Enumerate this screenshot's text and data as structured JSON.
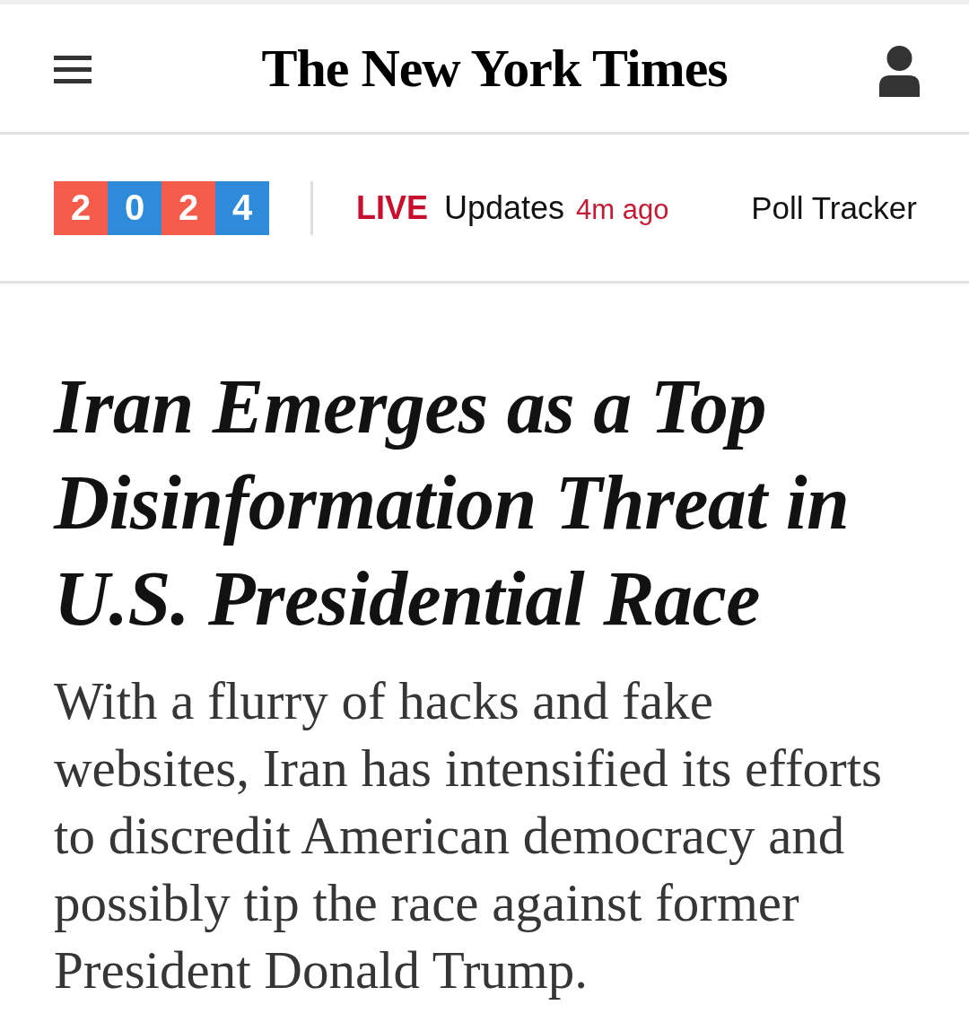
{
  "masthead": {
    "logo": "The New York Times"
  },
  "nav": {
    "badge": {
      "digits": [
        {
          "text": "2",
          "color": "#f45b4b"
        },
        {
          "text": "0",
          "color": "#2e8bd9"
        },
        {
          "text": "2",
          "color": "#f45b4b"
        },
        {
          "text": "4",
          "color": "#2e8bd9"
        }
      ]
    },
    "live": {
      "label": "LIVE",
      "text": "Updates",
      "time": "4m ago"
    },
    "link": "Poll Tracker"
  },
  "article": {
    "headline": "Iran Emerges as a Top Disinformation Threat in U.S. Presidential Race",
    "summary": "With a flurry of hacks and fake websites, Iran has intensified its efforts to discredit American democracy and possibly tip the race against former President Donald Trump."
  }
}
